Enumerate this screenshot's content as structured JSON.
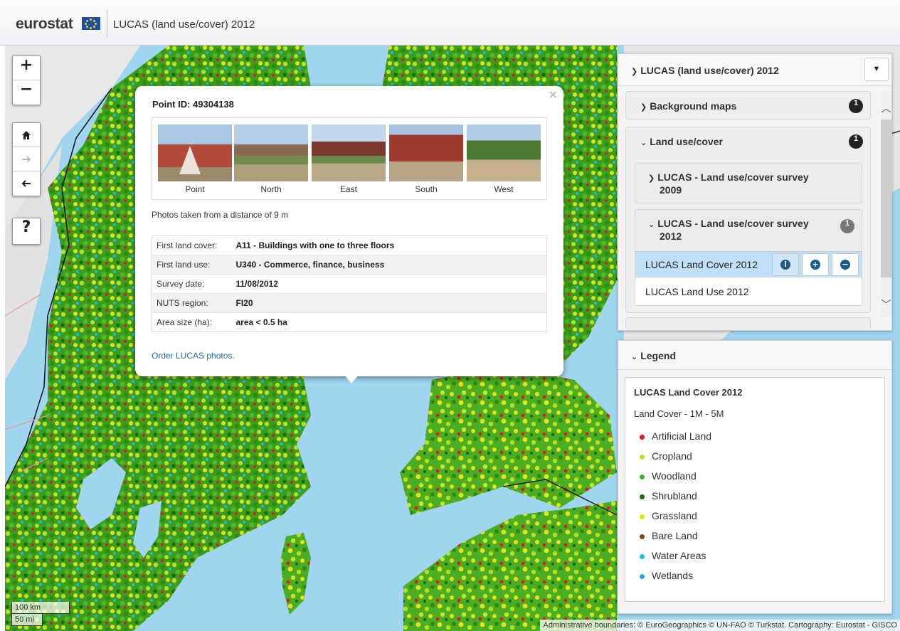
{
  "header": {
    "brand": "eurostat",
    "app_title": "LUCAS (land use/cover) 2012"
  },
  "map_tools": {
    "zoom_in": "+",
    "zoom_out": "−",
    "home_icon": "home-icon",
    "forward_icon": "arrow-right-icon",
    "back_icon": "arrow-left-icon",
    "help": "?"
  },
  "popup": {
    "title": "Point ID: 49304138",
    "close": "×",
    "photos": [
      {
        "caption": "Point"
      },
      {
        "caption": "North"
      },
      {
        "caption": "East"
      },
      {
        "caption": "South"
      },
      {
        "caption": "West"
      }
    ],
    "distance": "Photos taken from a distance of 9 m",
    "rows": [
      {
        "label": "First land cover:",
        "value": "A11 - Buildings with one to three floors"
      },
      {
        "label": "First land use:",
        "value": "U340 - Commerce, finance, business"
      },
      {
        "label": "Survey date:",
        "value": "11/08/2012"
      },
      {
        "label": "NUTS region:",
        "value": "FI20"
      },
      {
        "label": "Area size (ha):",
        "value": "area < 0.5 ha"
      }
    ],
    "order_link": "Order LUCAS photos."
  },
  "layers_panel": {
    "title": "LUCAS (land use/cover) 2012",
    "background_maps": {
      "label": "Background maps",
      "count": "1"
    },
    "land_use_cover": {
      "label": "Land use/cover",
      "count": "1"
    },
    "survey_2009": {
      "label_line1": "LUCAS - Land use/cover survey",
      "label_line2": "2009"
    },
    "survey_2012": {
      "label_line1": "LUCAS - Land use/cover survey",
      "label_line2": "2012",
      "count": "1"
    },
    "layers": [
      {
        "label": "LUCAS Land Cover 2012"
      },
      {
        "label": "LUCAS Land Use 2012"
      }
    ]
  },
  "legend_panel": {
    "title": "Legend",
    "layer": "LUCAS Land Cover 2012",
    "subtitle": "Land Cover - 1M - 5M",
    "items": [
      {
        "label": "Artificial Land",
        "color": "#e8101a"
      },
      {
        "label": "Cropland",
        "color": "#b4e61e"
      },
      {
        "label": "Woodland",
        "color": "#3fae29"
      },
      {
        "label": "Shrubland",
        "color": "#1d6b10"
      },
      {
        "label": "Grassland",
        "color": "#e6e600"
      },
      {
        "label": "Bare Land",
        "color": "#7a4a12"
      },
      {
        "label": "Water Areas",
        "color": "#19c3e6"
      },
      {
        "label": "Wetlands",
        "color": "#29a8e6"
      }
    ]
  },
  "scale": {
    "km": "100 km",
    "mi": "50 mi"
  },
  "attribution": "Administrative boundaries: © EuroGeographics © UN-FAO © Turkstat. Cartography: Eurostat - GISCO"
}
